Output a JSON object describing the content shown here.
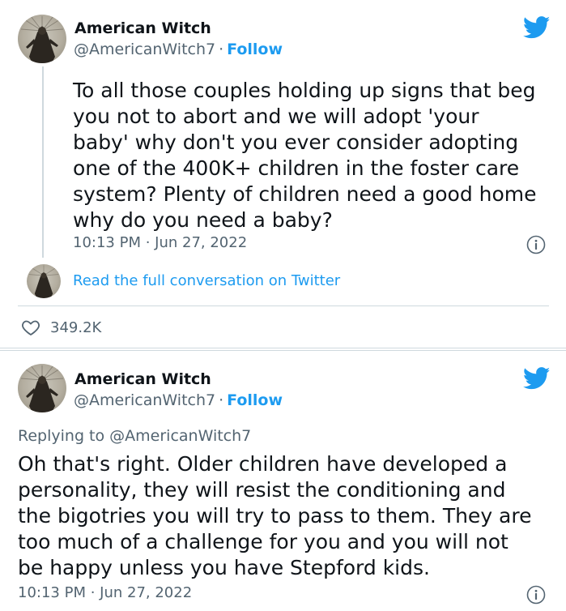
{
  "tweets": [
    {
      "author_name": "American Witch",
      "handle": "@AmericanWitch7",
      "separator": "·",
      "follow_label": "Follow",
      "text_lines": [
        "To all those couples holding up signs that beg",
        "you not to abort and we will adopt 'your",
        "baby' why don't you ever consider adopting",
        "one of the 400K+ children in the foster care",
        "system? Plenty of children need a good home",
        "why do you need a baby?"
      ],
      "timestamp": "10:13 PM · Jun 27, 2022",
      "read_full_label": "Read the full conversation on Twitter",
      "like_count": "349.2K"
    },
    {
      "author_name": "American Witch",
      "handle": "@AmericanWitch7",
      "separator": "·",
      "follow_label": "Follow",
      "replying_to": "Replying to @AmericanWitch7",
      "text_lines": [
        "Oh that's right. Older children have developed a",
        "personality, they will resist the conditioning and",
        "the bigotries you will try to pass to them. They are",
        "too much of a challenge for you and you will not",
        "be happy unless you have Stepford kids."
      ],
      "timestamp": "10:13 PM · Jun 27, 2022"
    }
  ],
  "icons": {
    "brand": "twitter-bird-icon",
    "info": "info-icon",
    "like": "heart-icon"
  },
  "colors": {
    "accent": "#1d9bf0",
    "text_primary": "#0f1419",
    "text_secondary": "#536471",
    "border": "#cfd9de"
  }
}
